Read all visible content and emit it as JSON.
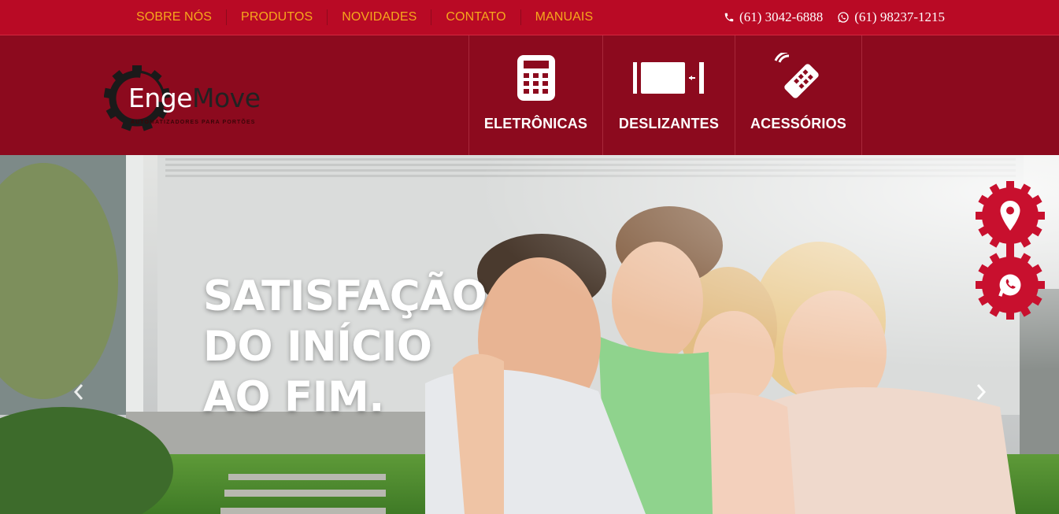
{
  "topbar": {
    "nav": [
      "SOBRE NÓS",
      "PRODUTOS",
      "NOVIDADES",
      "CONTATO",
      "MANUAIS"
    ],
    "phone": "(61) 3042-6888",
    "whatsapp": "(61) 98237-1215"
  },
  "brand": {
    "name_light": "Enge",
    "name_dark": "Move",
    "tagline": "AUTOMATIZADORES PARA PORTÕES"
  },
  "categories": [
    {
      "label": "ELETRÔNICAS",
      "icon": "keypad-icon"
    },
    {
      "label": "DESLIZANTES",
      "icon": "sliding-gate-icon"
    },
    {
      "label": "ACESSÓRIOS",
      "icon": "remote-control-icon"
    }
  ],
  "hero": {
    "headline": [
      "SATISFAÇÃO",
      "DO INÍCIO",
      "AO FIM."
    ],
    "prev_icon": "chevron-left-icon",
    "next_icon": "chevron-right-icon"
  },
  "floating": [
    {
      "icon": "location-pin-icon"
    },
    {
      "icon": "whatsapp-icon"
    }
  ],
  "colors": {
    "topbar": "#b90a25",
    "header": "#8c0a1e",
    "nav_text": "#f6a81c",
    "accent_red": "#c8102e"
  }
}
